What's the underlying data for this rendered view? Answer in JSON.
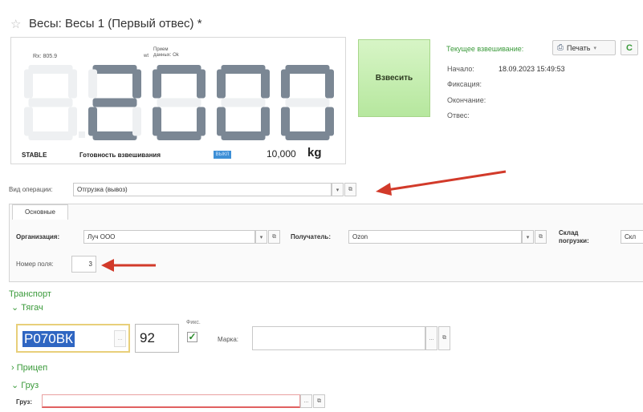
{
  "window": {
    "title": "Весы: Весы 1 (Первый отвес) *",
    "star_icon": "star-icon"
  },
  "display": {
    "rx": "Rx: 805.9",
    "wt_prefix": "wt",
    "wt_status": "Прием данных: Ok",
    "digits_bg": "8.8.8.8.8",
    "value": "2000",
    "stable": "STABLE",
    "ready_label": "Готовность взвешивания",
    "ready_badge": "ВЫКЛ",
    "capacity": "10,000",
    "unit": "kg"
  },
  "weigh_button": "Взвесить",
  "current": {
    "label": "Текущее взвешивание:",
    "print_label": "Печать",
    "refresh_label": "C",
    "start_label": "Начало:",
    "start_value": "18.09.2023 15:49:53",
    "fix_label": "Фиксация:",
    "end_label": "Окончание:",
    "weight_label": "Отвес:"
  },
  "operation": {
    "label": "Вид операции:",
    "value": "Отгрузка (вывоз)"
  },
  "tabs": {
    "main": "Основные"
  },
  "main_tab": {
    "org_label": "Организация:",
    "org_value": "Луч ООО",
    "recipient_label": "Получатель:",
    "recipient_value": "Ozon",
    "warehouse_label_1": "Склад",
    "warehouse_label_2": "погрузки:",
    "warehouse_value": "Скл",
    "field_no_label": "Номер поля:",
    "field_no_value": "3"
  },
  "transport": {
    "title": "Транспорт",
    "tractor": "Тягач",
    "plate": "Р070ВК",
    "region": "92",
    "fix_label": "Фикс.",
    "brand_label": "Марка:",
    "trailer": "Прицеп",
    "cargo_section": "Груз",
    "cargo_label": "Груз:"
  },
  "colors": {
    "accent_green": "#3a9a3a",
    "arrow_red": "#d23a2a",
    "weigh_green": "#c6efb0"
  }
}
